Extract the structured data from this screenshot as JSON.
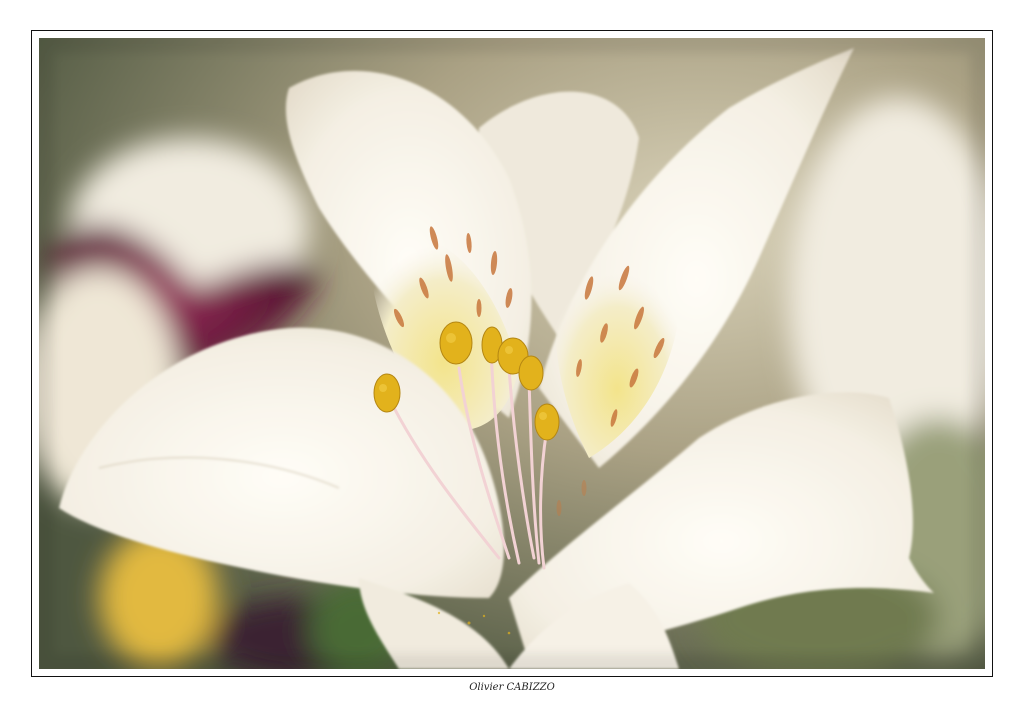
{
  "photo": {
    "subject": "white-lily-flower",
    "palette": {
      "background_dark": "#3f4a35",
      "background_light": "#d8d0b8",
      "petal": "#f7f3ea",
      "petal_shadow": "#e7dfcf",
      "throat": "#efe39a",
      "speckle": "#c8773d",
      "pollen": "#e2b21c",
      "stem": "#f3d8d8",
      "purple": "#6f1239"
    }
  },
  "signature": {
    "text": "Olivier CABIZZO"
  }
}
